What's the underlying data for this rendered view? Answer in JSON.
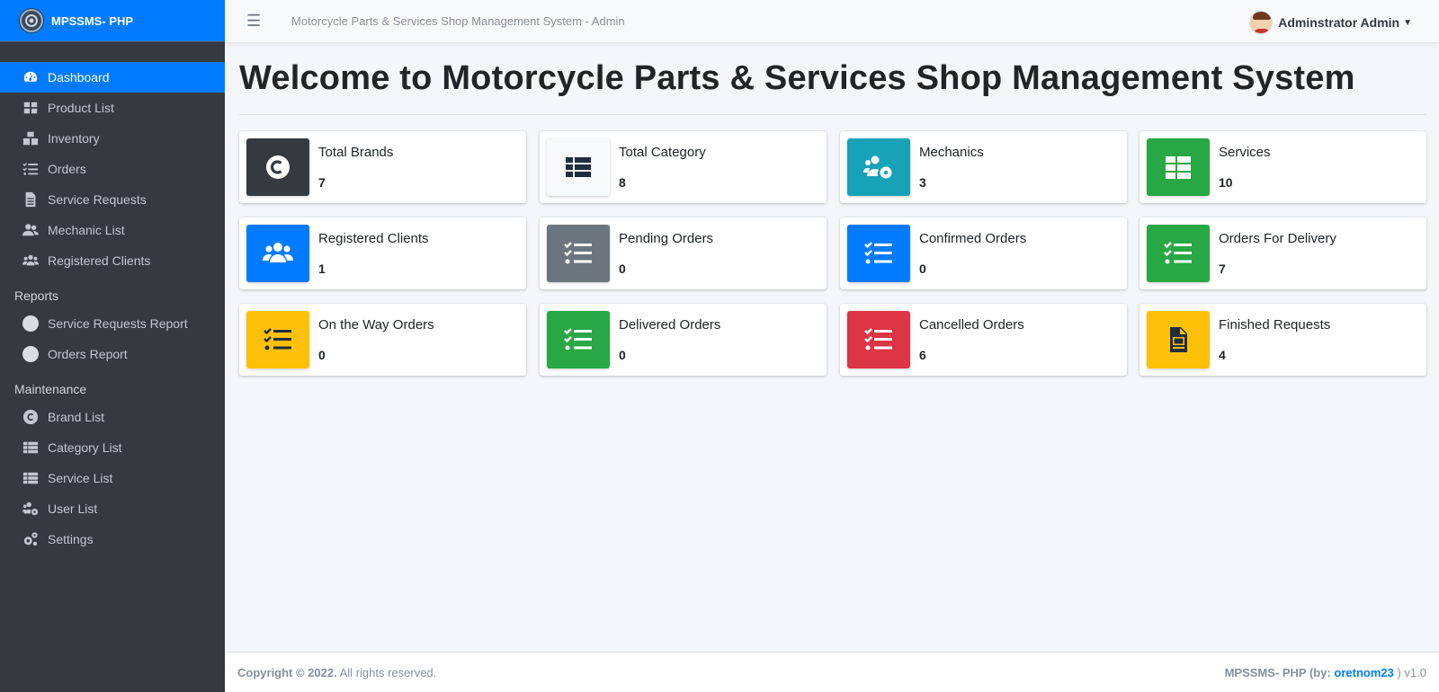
{
  "brand": {
    "name": "MPSSMS- PHP"
  },
  "topbar": {
    "title": "Motorcycle Parts & Services Shop Management System - Admin",
    "user": "Adminstrator Admin"
  },
  "sidebar": {
    "items": [
      {
        "label": "Dashboard",
        "icon": "dashboard-icon"
      },
      {
        "label": "Product List",
        "icon": "th-large-icon"
      },
      {
        "label": "Inventory",
        "icon": "boxes-icon"
      },
      {
        "label": "Orders",
        "icon": "tasks-icon"
      },
      {
        "label": "Service Requests",
        "icon": "file-alt-icon"
      },
      {
        "label": "Mechanic List",
        "icon": "users-icon"
      },
      {
        "label": "Registered Clients",
        "icon": "users-group-icon"
      }
    ],
    "reports_header": "Reports",
    "reports": [
      {
        "label": "Service Requests Report",
        "icon": "circle-icon"
      },
      {
        "label": "Orders Report",
        "icon": "circle-icon"
      }
    ],
    "maintenance_header": "Maintenance",
    "maintenance": [
      {
        "label": "Brand List",
        "icon": "copyright-icon"
      },
      {
        "label": "Category List",
        "icon": "th-list-icon"
      },
      {
        "label": "Service List",
        "icon": "th-list-icon"
      },
      {
        "label": "User List",
        "icon": "users-cog-icon"
      },
      {
        "label": "Settings",
        "icon": "cogs-icon"
      }
    ]
  },
  "main": {
    "heading": "Welcome to Motorcycle Parts & Services Shop Management System",
    "cards": [
      {
        "label": "Total Brands",
        "value": "7",
        "color": "#343a40",
        "icon": "copyright-icon"
      },
      {
        "label": "Total Category",
        "value": "8",
        "color": "#f8f9fa",
        "icon": "th-list-icon"
      },
      {
        "label": "Mechanics",
        "value": "3",
        "color": "#17a2b8",
        "icon": "users-cog-icon"
      },
      {
        "label": "Services",
        "value": "10",
        "color": "#28a745",
        "icon": "table-icon"
      },
      {
        "label": "Registered Clients",
        "value": "1",
        "color": "#007bff",
        "icon": "users-icon"
      },
      {
        "label": "Pending Orders",
        "value": "0",
        "color": "#6c757d",
        "icon": "tasks-icon"
      },
      {
        "label": "Confirmed Orders",
        "value": "0",
        "color": "#007bff",
        "icon": "tasks-icon"
      },
      {
        "label": "Orders For Delivery",
        "value": "7",
        "color": "#28a745",
        "icon": "tasks-icon"
      },
      {
        "label": "On the Way Orders",
        "value": "0",
        "color": "#ffc107",
        "icon": "tasks-icon"
      },
      {
        "label": "Delivered Orders",
        "value": "0",
        "color": "#28a745",
        "icon": "tasks-icon"
      },
      {
        "label": "Cancelled Orders",
        "value": "6",
        "color": "#dc3545",
        "icon": "tasks-icon"
      },
      {
        "label": "Finished Requests",
        "value": "4",
        "color": "#ffc107",
        "icon": "file-invoice-icon"
      }
    ]
  },
  "footer": {
    "copyright": "Copyright © 2022.",
    "rights": " All rights reserved.",
    "credit_prefix": "MPSSMS- PHP (by: ",
    "author": "oretnom23",
    "credit_suffix": " ) v1.0"
  }
}
